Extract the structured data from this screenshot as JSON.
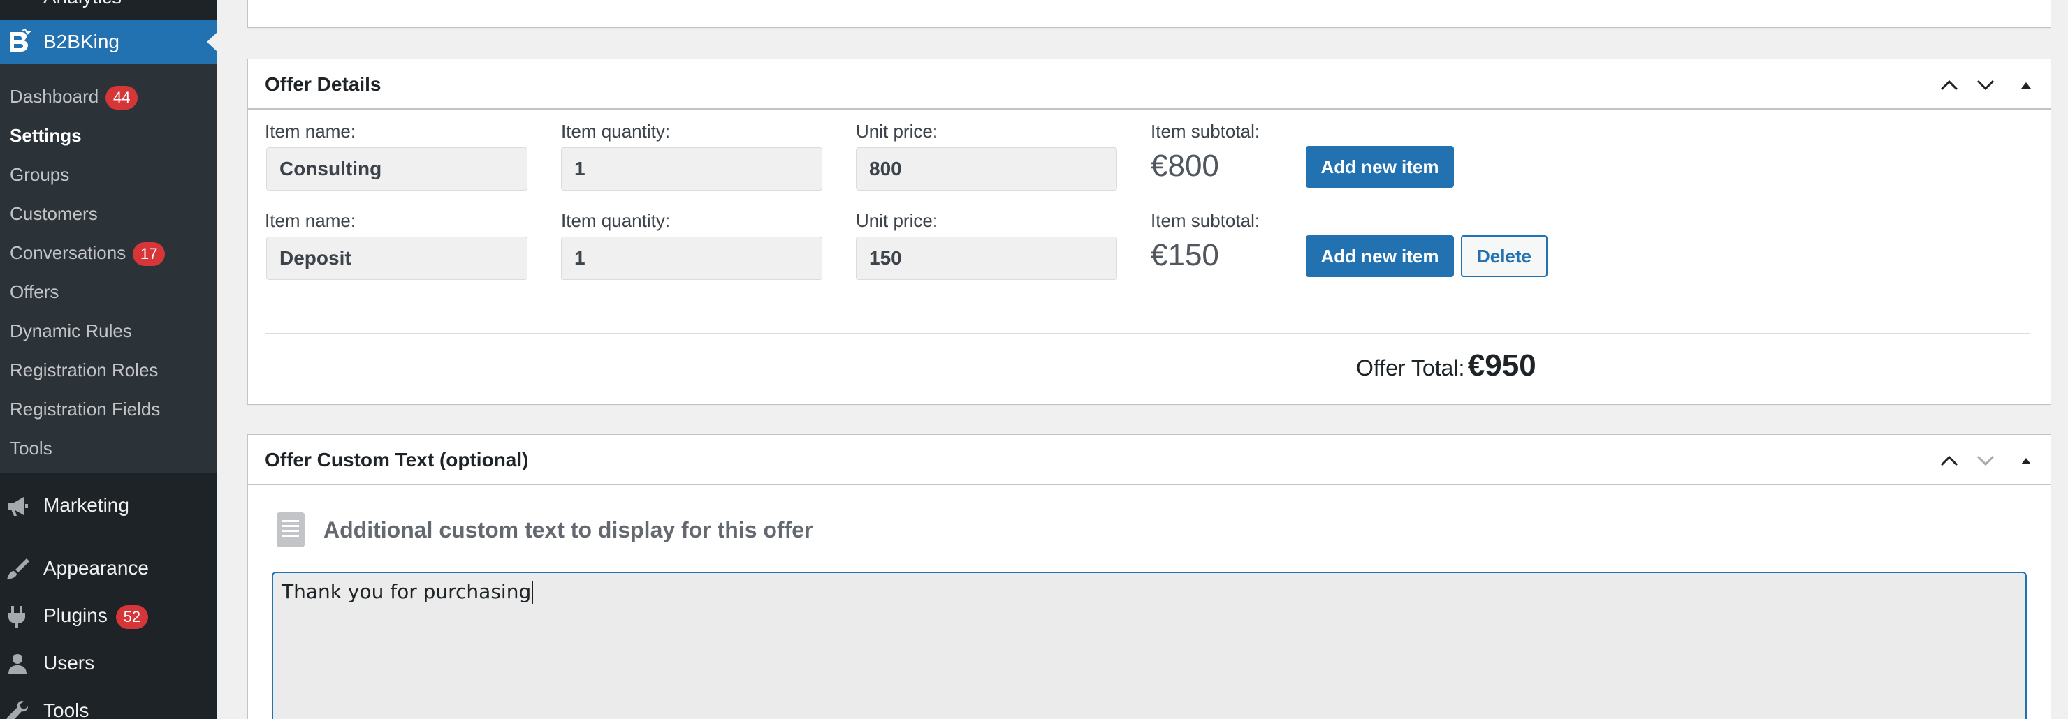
{
  "sidebar": {
    "analytics_label": "Analytics",
    "active": {
      "label": "B2BKing",
      "icon": "b2bking-logo-icon"
    },
    "submenu": [
      {
        "label": "Dashboard",
        "badge": "44"
      },
      {
        "label": "Settings",
        "current": true
      },
      {
        "label": "Groups"
      },
      {
        "label": "Customers"
      },
      {
        "label": "Conversations",
        "badge": "17"
      },
      {
        "label": "Offers"
      },
      {
        "label": "Dynamic Rules"
      },
      {
        "label": "Registration Roles"
      },
      {
        "label": "Registration Fields"
      },
      {
        "label": "Tools"
      }
    ],
    "menu": [
      {
        "label": "Marketing",
        "icon": "megaphone-icon"
      },
      {
        "label": "Appearance",
        "icon": "paintbrush-icon"
      },
      {
        "label": "Plugins",
        "icon": "plugin-icon",
        "badge": "52"
      },
      {
        "label": "Users",
        "icon": "user-icon"
      },
      {
        "label": "Tools",
        "icon": "wrench-icon"
      }
    ]
  },
  "offer_details": {
    "title": "Offer Details",
    "labels": {
      "item_name": "Item name:",
      "item_quantity": "Item quantity:",
      "unit_price": "Unit price:",
      "item_subtotal": "Item subtotal:"
    },
    "items": [
      {
        "name": "Consulting",
        "quantity": "1",
        "unit_price": "800",
        "subtotal": "€800",
        "add_label": "Add new item"
      },
      {
        "name": "Deposit",
        "quantity": "1",
        "unit_price": "150",
        "subtotal": "€150",
        "add_label": "Add new item",
        "delete_label": "Delete"
      }
    ],
    "total_label": "Offer Total:",
    "total_value": "€950"
  },
  "custom_text": {
    "title": "Offer Custom Text (optional)",
    "field_label": "Additional custom text to display for this offer",
    "value": "Thank you for purchasing"
  },
  "colors": {
    "accent": "#2271b1",
    "sidebar_bg": "#1d2327",
    "submenu_bg": "#2c3338",
    "badge": "#d63638"
  }
}
